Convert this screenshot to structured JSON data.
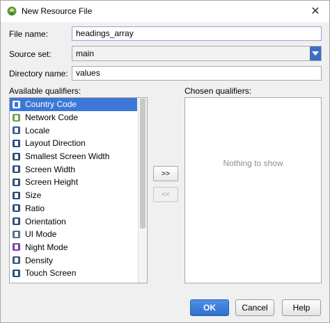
{
  "window": {
    "title": "New Resource File"
  },
  "form": {
    "file_name_label": "File name:",
    "file_name_value": "headings_array",
    "source_set_label": "Source set:",
    "source_set_value": "main",
    "directory_label": "Directory name:",
    "directory_value": "values"
  },
  "qualifiers": {
    "available_label": "Available qualifiers:",
    "chosen_label": "Chosen qualifiers:",
    "empty_text": "Nothing to show",
    "items": [
      {
        "label": "Country Code",
        "icon": "country-code-icon",
        "selected": true
      },
      {
        "label": "Network Code",
        "icon": "network-code-icon"
      },
      {
        "label": "Locale",
        "icon": "locale-globe-icon"
      },
      {
        "label": "Layout Direction",
        "icon": "layout-direction-icon"
      },
      {
        "label": "Smallest Screen Width",
        "icon": "smallest-screen-width-icon"
      },
      {
        "label": "Screen Width",
        "icon": "screen-width-icon"
      },
      {
        "label": "Screen Height",
        "icon": "screen-height-icon"
      },
      {
        "label": "Size",
        "icon": "size-icon"
      },
      {
        "label": "Ratio",
        "icon": "ratio-icon"
      },
      {
        "label": "Orientation",
        "icon": "orientation-icon"
      },
      {
        "label": "UI Mode",
        "icon": "ui-mode-icon"
      },
      {
        "label": "Night Mode",
        "icon": "night-mode-icon"
      },
      {
        "label": "Density",
        "icon": "density-icon"
      },
      {
        "label": "Touch Screen",
        "icon": "touch-screen-icon"
      }
    ],
    "add_label": ">>",
    "remove_label": "<<"
  },
  "buttons": {
    "ok": "OK",
    "cancel": "Cancel",
    "help": "Help"
  },
  "colors": {
    "accent": "#3d78d6",
    "primary_button": "#2f6fd0"
  }
}
